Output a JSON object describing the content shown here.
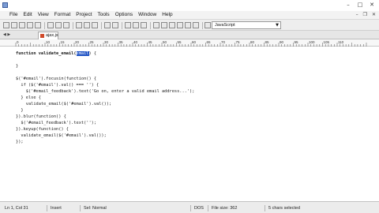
{
  "window": {
    "minimize": "–",
    "maximize": "□",
    "close": "✕"
  },
  "menu": {
    "items": [
      "File",
      "Edit",
      "View",
      "Format",
      "Project",
      "Tools",
      "Options",
      "Window",
      "Help"
    ],
    "doc_minimize": "–",
    "doc_restore": "❐",
    "doc_close": "✕"
  },
  "toolbar": {
    "language": "JavaScript"
  },
  "tab": {
    "label": "ajax.js"
  },
  "ruler": {
    "labels": [
      "0",
      "10",
      "15",
      "20",
      "25",
      "30",
      "35",
      "40",
      "45",
      "50",
      "55",
      "60",
      "65",
      "70",
      "75",
      "80",
      "85",
      "90",
      "95",
      "100",
      "105",
      "110"
    ]
  },
  "code": {
    "line1_a": "function validate_email(",
    "line1_sel": "email",
    "line1_b": ") {",
    "line2": "}",
    "lines": [
      "$('#email').focusin(function() {",
      "  if ($('#email').val() === '') {",
      "    $('#email_feedback').text('Go on, enter a valid email address...');",
      "  } else {",
      "    validate_email($('#email').val());",
      "  }",
      "}).blur(function() {",
      "  $('#email_feedback').text('');",
      "}).keyup(function() {",
      "  validate_email($('#email').val());",
      "});"
    ]
  },
  "status": {
    "position": "Ln 1, Col 31",
    "mode": "Insert",
    "format": "Sel: Normal",
    "encoding": "DOS",
    "filesize": "File size: 362",
    "selection": "5 chars selected"
  }
}
